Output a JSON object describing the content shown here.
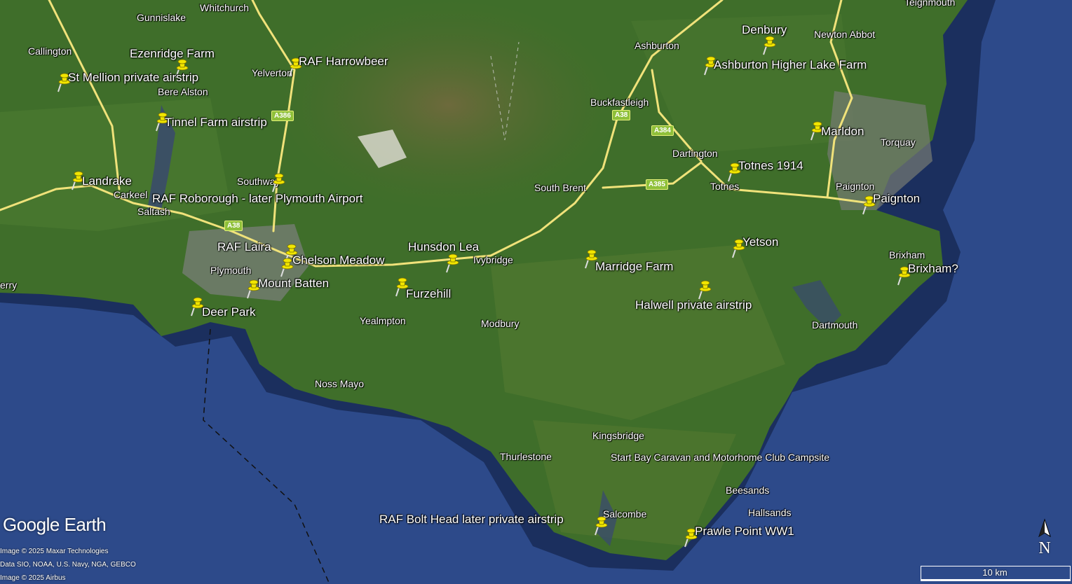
{
  "app": {
    "logo_text": "Google Earth"
  },
  "credits": [
    "Image © 2025 Maxar Technologies",
    "Data SIO, NOAA, U.S. Navy, NGA, GEBCO",
    "Image © 2025 Airbus"
  ],
  "scale": {
    "label": "10 km"
  },
  "compass": {
    "label": "N"
  },
  "colors": {
    "sea": "#2d4a8a",
    "land": "#3f6e2a",
    "road": "#f0e27a",
    "pin": "#f2e600"
  },
  "places": [
    "Gunnislake",
    "Whitchurch",
    "Callington",
    "Bere Alston",
    "Yelverton",
    "Landrake",
    "Carkeel",
    "Saltash",
    "Southway",
    "Plymouth",
    "erry",
    "Yealmpton",
    "Noss Mayo",
    "Modbury",
    "Ivybridge",
    "South Brent",
    "Buckfastleigh",
    "Ashburton",
    "Dartington",
    "Totnes",
    "Denbury",
    "Newton Abbot",
    "Torquay",
    "Paignton",
    "Brixham",
    "Dartmouth",
    "Kingsbridge",
    "Thurlestone",
    "Salcombe",
    "Beesands",
    "Hallsands",
    "Teignmouth"
  ],
  "roads": [
    "A386",
    "A38",
    "A384",
    "A385",
    "A38"
  ],
  "pins": [
    "Ezenridge Farm",
    "St Mellion private airstrip",
    "Tinnel Farm airstrip",
    "Landrake",
    "RAF Harrowbeer",
    "RAF Roborough - later Plymouth Airport",
    "RAF Laira",
    "Chelson Meadow",
    "Mount Batten",
    "Deer Park",
    "Hunsdon Lea",
    "Furzehill",
    "Marridge Farm",
    "Halwell private airstrip",
    "Yetson",
    "Totnes 1914",
    "Ashburton Higher Lake Farm",
    "Denbury",
    "Marldon",
    "Paignton",
    "Brixham?",
    "Start Bay Caravan and Motorhome Club Campsite",
    "RAF Bolt Head later private airstrip",
    "Prawle Point WW1"
  ]
}
